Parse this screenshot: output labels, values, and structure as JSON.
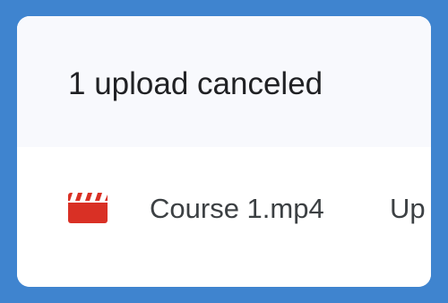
{
  "upload_panel": {
    "title": "1 upload canceled",
    "items": [
      {
        "file_name": "Course 1.mp4",
        "file_type_icon": "video-file-icon",
        "status": "Up"
      }
    ]
  },
  "colors": {
    "background": "#3f84cf",
    "panel": "#ffffff",
    "header_bg": "#f8f9fd",
    "video_icon": "#d93025",
    "text": "#202124"
  }
}
